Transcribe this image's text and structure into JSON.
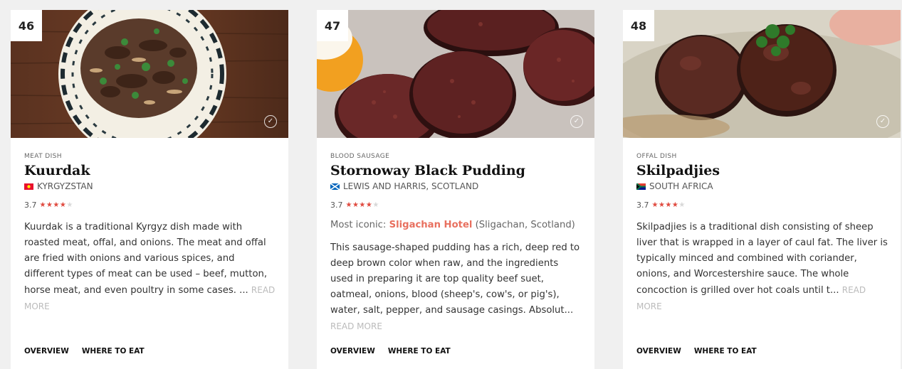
{
  "cards": [
    {
      "rank": "46",
      "category": "MEAT DISH",
      "name": "Kuurdak",
      "origin": "KYRGYZSTAN",
      "rating": "3.7",
      "stars": "★★★★★",
      "description": "Kuurdak is a traditional Kyrgyz dish made with roasted meat, offal, and onions. The meat and offal are fried with onions and various spices, and different types of meat can be used – beef, mutton, horse meat, and even poultry in some cases. ...",
      "read_more": "READ MORE",
      "tab_overview": "OVERVIEW",
      "tab_where": "WHERE TO EAT"
    },
    {
      "rank": "47",
      "category": "BLOOD SAUSAGE",
      "name": "Stornoway Black Pudding",
      "origin": "LEWIS AND HARRIS, SCOTLAND",
      "rating": "3.7",
      "stars": "★★★★★",
      "iconic_label": "Most iconic:",
      "iconic_place": "Sligachan Hotel",
      "iconic_location": "(Sligachan, Scotland)",
      "description": "This sausage-shaped pudding has a rich, deep red to deep brown color when raw, and the ingredients used in preparing it are top quality beef suet, oatmeal, onions, blood (sheep's, cow's, or pig's), water, salt, pepper, and sausage casings. Absolut...",
      "read_more": "READ MORE",
      "tab_overview": "OVERVIEW",
      "tab_where": "WHERE TO EAT"
    },
    {
      "rank": "48",
      "category": "OFFAL DISH",
      "name": "Skilpadjies",
      "origin": "SOUTH AFRICA",
      "rating": "3.7",
      "stars": "★★★★★",
      "description": "Skilpadjies is a traditional dish consisting of sheep liver that is wrapped in a layer of caul fat. The liver is typically minced and combined with coriander, onions, and Worcestershire sauce. The whole concoction is grilled over hot coals until t...",
      "read_more": "READ MORE",
      "tab_overview": "OVERVIEW",
      "tab_where": "WHERE TO EAT"
    }
  ],
  "colors": {
    "star": "#e04a3f",
    "link": "#e8705f",
    "read_more": "#bbbbbb"
  },
  "icons": [
    "check-circle-icon",
    "flag-kyrgyzstan-icon",
    "flag-scotland-icon",
    "flag-south-africa-icon"
  ]
}
